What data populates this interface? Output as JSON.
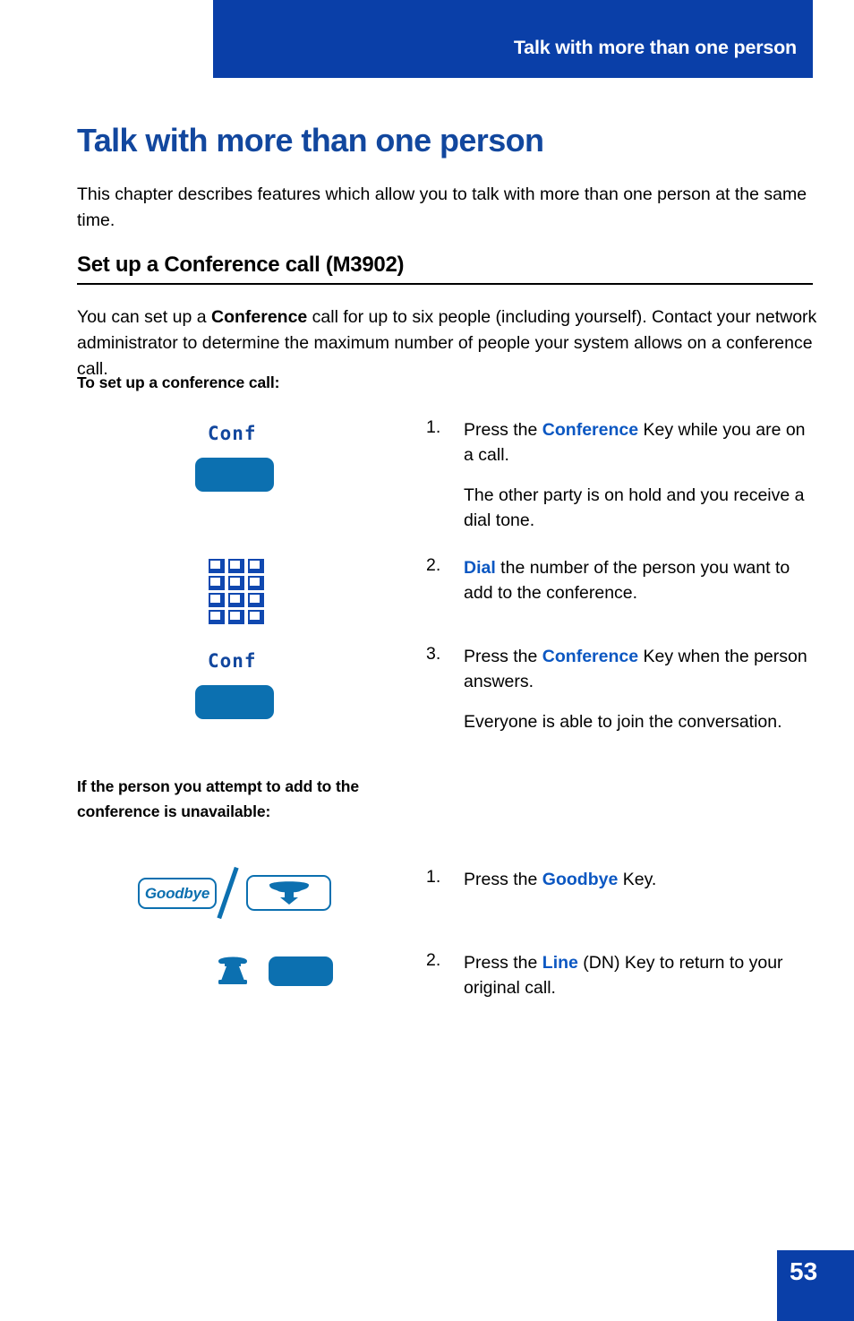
{
  "header": {
    "running_title": "Talk with more than one person"
  },
  "page": {
    "title": "Talk with more than one person",
    "intro": "This chapter describes features which allow you to talk with more than one person at the same time.",
    "page_number": "53"
  },
  "section": {
    "heading": "Set up a Conference call (M3902)",
    "body_before_bold": "You can set up a ",
    "body_bold": "Conference",
    "body_after_bold": " call for up to six people (including yourself). Contact your network administrator to determine the maximum number of people your system allows on a conference call.",
    "procedure_intro": "To set up a conference call:",
    "alt_procedure_intro": "If the person you attempt to add to the conference is unavailable:"
  },
  "icons": {
    "conf_label": "Conf",
    "goodbye_label": "Goodbye",
    "keypad_name": "dialpad-icon",
    "handset_down_name": "handset-hangup-icon",
    "desk_phone_name": "desk-phone-icon",
    "line_key_name": "line-key-button"
  },
  "steps_main": [
    {
      "number": "1.",
      "text_before": "Press the ",
      "key": "Conference",
      "text_after": " Key while you are on a call.",
      "note": "The other party is on hold and you receive a dial tone."
    },
    {
      "number": "2.",
      "text_before": "",
      "key": "Dial",
      "text_after": " the number of the person you want to add to the conference.",
      "note": ""
    },
    {
      "number": "3.",
      "text_before": "Press the ",
      "key": "Conference",
      "text_after": " Key when the person answers.",
      "note": "Everyone is able to join the conversation."
    }
  ],
  "steps_alt": [
    {
      "number": "1.",
      "text_before": "Press the ",
      "key": "Goodbye",
      "text_after": " Key.",
      "note": ""
    },
    {
      "number": "2.",
      "text_before": "Press the ",
      "key": "Line",
      "text_after": " (DN) Key to return to your original call.",
      "note": ""
    }
  ],
  "colors": {
    "header_blue": "#0A3FA8",
    "title_blue": "#12479E",
    "key_blue": "#0C70B0",
    "accent_blue": "#0B57C2"
  }
}
